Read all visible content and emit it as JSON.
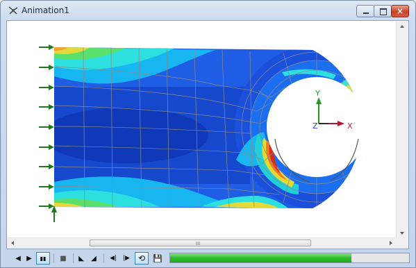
{
  "window": {
    "title": "Animation1",
    "controls": {
      "minimize": "minimize",
      "maximize": "maximize",
      "close": "×"
    }
  },
  "viewport": {
    "triad": {
      "y_label": "Y",
      "z_label": "Z",
      "x_label": "X"
    },
    "colors": {
      "bg": "#ffffff",
      "mesh_line": "#8a8a8a",
      "constraint_arrow": "#1f7a1f"
    }
  },
  "scrollbars": {
    "horizontal_grip": "III"
  },
  "toolbar": {
    "buttons": [
      {
        "name": "prev-frame-button",
        "icon": "◀"
      },
      {
        "name": "play-button",
        "icon": "▶"
      },
      {
        "name": "pause-button",
        "icon": "▮▮",
        "active": true
      },
      {
        "name": "stop-button",
        "icon": "■"
      },
      {
        "name": "first-frame-button",
        "icon": "◣"
      },
      {
        "name": "last-frame-button",
        "icon": "◢"
      },
      {
        "name": "step-back-button",
        "icon": "◀|"
      },
      {
        "name": "step-forward-button",
        "icon": "|▶"
      },
      {
        "name": "loop-button",
        "icon": "⟲",
        "active": true
      },
      {
        "name": "save-button",
        "icon": "💾"
      }
    ],
    "progress_fraction": 0.76
  }
}
